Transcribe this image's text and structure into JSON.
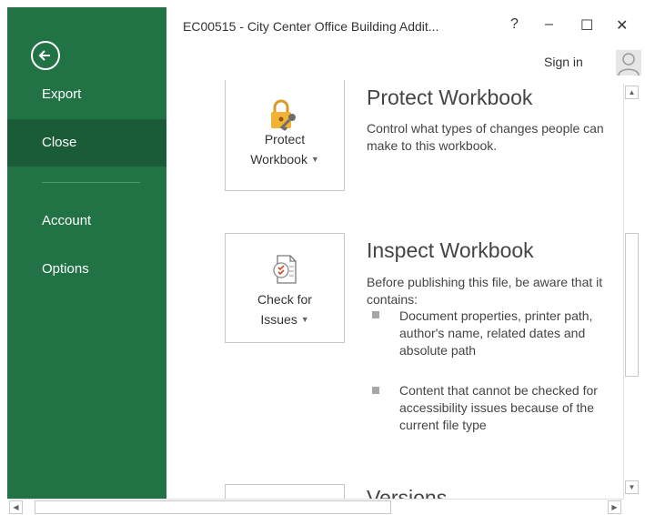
{
  "window": {
    "title": "EC00515 - City Center Office Building Addit...",
    "help_label": "?",
    "minimize_label": "–",
    "maximize_label": "☐",
    "close_label": "✕",
    "signin_label": "Sign in"
  },
  "sidebar": {
    "items": [
      {
        "label": "Export"
      },
      {
        "label": "Close"
      },
      {
        "label": "Account"
      },
      {
        "label": "Options"
      }
    ],
    "active_color": "#1a5c38",
    "background_color": "#217346"
  },
  "sections": [
    {
      "button_line1": "Protect",
      "button_line2": "Workbook",
      "title": "Protect Workbook",
      "description": "Control what types of changes people can make to this workbook."
    },
    {
      "button_line1": "Check for",
      "button_line2": "Issues",
      "title": "Inspect Workbook",
      "description": "Before publishing this file, be aware that it contains:",
      "bullets": [
        "Document properties, printer path, author's name, related dates and absolute path",
        "Content that cannot be checked for accessibility issues because of the current file type"
      ]
    },
    {
      "title": "Versions"
    }
  ],
  "icons": {
    "back": "back-arrow-icon",
    "protect": "lock-key-icon",
    "check": "document-check-icon",
    "user": "user-avatar-icon"
  }
}
